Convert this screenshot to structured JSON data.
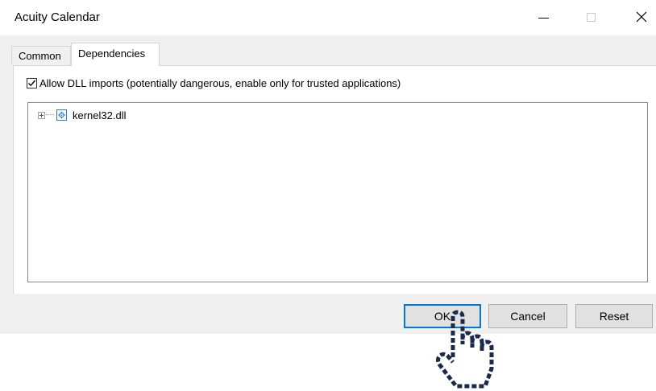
{
  "window": {
    "title": "Acuity Calendar"
  },
  "tabs": [
    {
      "label": "Common",
      "active": false
    },
    {
      "label": "Dependencies",
      "active": true
    }
  ],
  "dependencies": {
    "allow_dll_label": "Allow DLL imports (potentially dangerous, enable only for trusted applications)",
    "allow_dll_checked": true,
    "tree_items": [
      {
        "label": "kernel32.dll",
        "icon": "gear-dll-icon",
        "expandable": true
      }
    ]
  },
  "buttons": {
    "ok": "OK",
    "cancel": "Cancel",
    "reset": "Reset"
  },
  "colors": {
    "accent": "#0078d7",
    "pointer_fill": "#1b2a4a"
  }
}
